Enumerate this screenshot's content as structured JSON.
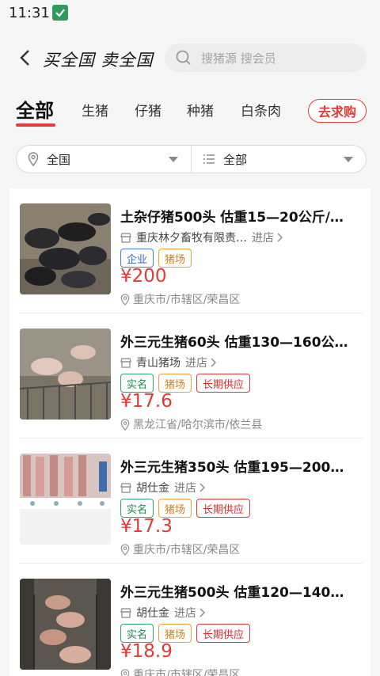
{
  "status_bar": {
    "time": "11:31"
  },
  "header": {
    "logo_text": "买全国 卖全国",
    "search_placeholder": "搜猪源 搜会员"
  },
  "tabs": [
    {
      "label": "全部",
      "active": true
    },
    {
      "label": "生猪"
    },
    {
      "label": "仔猪"
    },
    {
      "label": "种猪"
    },
    {
      "label": "白条肉"
    }
  ],
  "seek_button": "去求购",
  "filters": {
    "region": "全国",
    "category": "全部"
  },
  "listings": [
    {
      "title": "土杂仔猪500头 估重15—20公斤/…",
      "shop": "重庆林夕畜牧有限责…",
      "enter": "进店",
      "tags": [
        {
          "text": "企业",
          "color": "blue"
        },
        {
          "text": "猪场",
          "color": "orange"
        }
      ],
      "price": "¥200",
      "location": "重庆市/市辖区/荣昌区"
    },
    {
      "title": "外三元生猪60头 估重130—160公…",
      "shop": "青山猪场",
      "enter": "进店",
      "tags": [
        {
          "text": "实名",
          "color": "green"
        },
        {
          "text": "猪场",
          "color": "orange"
        },
        {
          "text": "长期供应",
          "color": "red"
        }
      ],
      "price": "¥17.6",
      "location": "黑龙江省/哈尔滨市/依兰县"
    },
    {
      "title": "外三元生猪350头 估重195—200…",
      "shop": "胡仕金",
      "enter": "进店",
      "tags": [
        {
          "text": "实名",
          "color": "green"
        },
        {
          "text": "猪场",
          "color": "orange"
        },
        {
          "text": "长期供应",
          "color": "red"
        }
      ],
      "price": "¥17.3",
      "location": "重庆市/市辖区/荣昌区"
    },
    {
      "title": "外三元生猪500头 估重120—140…",
      "shop": "胡仕金",
      "enter": "进店",
      "tags": [
        {
          "text": "实名",
          "color": "green"
        },
        {
          "text": "猪场",
          "color": "orange"
        },
        {
          "text": "长期供应",
          "color": "red"
        }
      ],
      "price": "¥18.9",
      "location": "重庆市/市辖区/荣昌区"
    }
  ]
}
